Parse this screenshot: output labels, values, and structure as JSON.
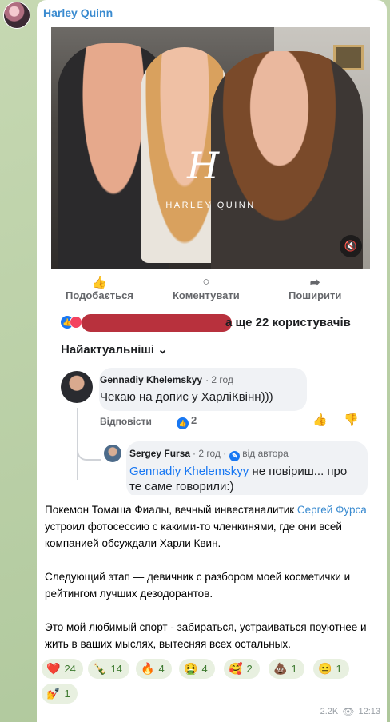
{
  "channel": {
    "name": "Harley Quinn"
  },
  "embedded_post": {
    "overlay_logo_letter": "H",
    "overlay_logo_text": "HARLEY QUINN",
    "actions": [
      {
        "icon": "thumbs-up-icon",
        "label": "Подобається"
      },
      {
        "icon": "comment-icon",
        "label": "Коментувати"
      },
      {
        "icon": "share-icon",
        "label": "Поширити"
      }
    ],
    "reactions_summary": "а ще 22 користувачів",
    "sort_label": "Найактуальніші",
    "comment": {
      "author": "Gennadiy Khelemskyy",
      "time": "· 2 год",
      "text": "Чекаю на допис у ХарліКвінн)))",
      "reply_label": "Відповісти",
      "likes": "2"
    },
    "reply": {
      "author": "Sergey Fursa",
      "time": "· 2 год ·",
      "author_tag": "від автора",
      "mention": "Gennadiy Khelemskyy",
      "text": " не повіриш... про те саме говорили:)"
    }
  },
  "post": {
    "p1_before": "Покемон Томаша Фиалы, вечный инвестаналитик ",
    "p1_link": "Сергей Фурса",
    "p1_after": " устроил фотосессию с какими-то членкинями, где они всей компанией обсуждали Харли Квин.",
    "p2": "Следующий этап — девичник с разбором моей косметички и рейтингом лучших дезодорантов.",
    "p3": "Это мой любимый спорт - забираться, устраиваться поуютнее и жить в ваших мыслях, вытесняя всех остальных."
  },
  "reactions": [
    {
      "emoji": "❤️",
      "count": "24"
    },
    {
      "emoji": "🍾",
      "count": "14"
    },
    {
      "emoji": "🔥",
      "count": "4"
    },
    {
      "emoji": "🤮",
      "count": "4"
    },
    {
      "emoji": "🥰",
      "count": "2"
    },
    {
      "emoji": "💩",
      "count": "1"
    },
    {
      "emoji": "😐",
      "count": "1"
    },
    {
      "emoji": "💅",
      "count": "1"
    }
  ],
  "footer": {
    "views": "2.2K",
    "time": "12:13"
  },
  "colors": {
    "link": "#3a8bd0",
    "fb_blue": "#1877f2",
    "reaction_text": "#3d7a2f"
  }
}
